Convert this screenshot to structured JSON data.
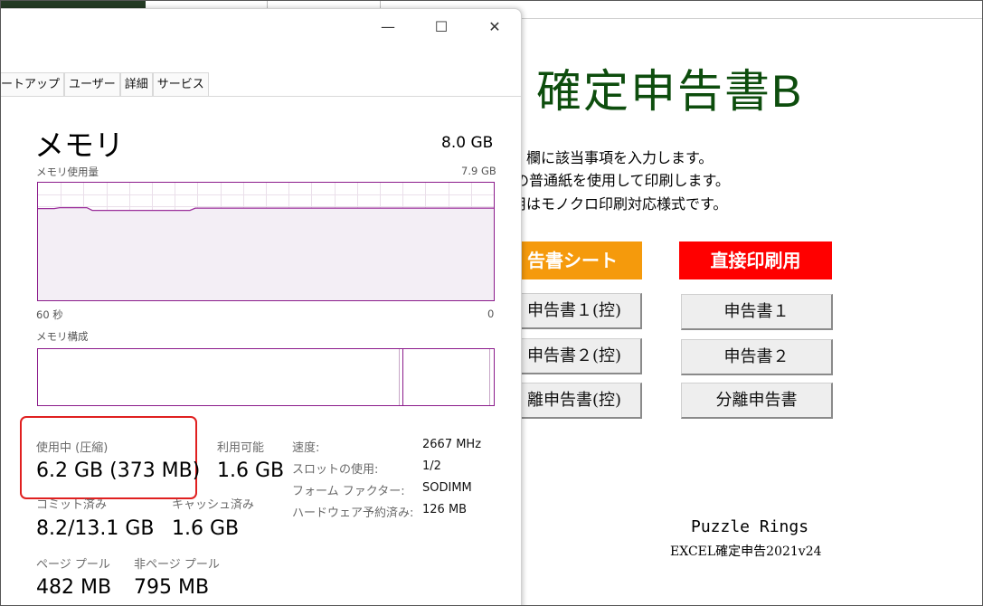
{
  "excel": {
    "title": "確定申告書B",
    "instructions": [
      "欄に該当事項を入力します。",
      "の普通紙を使用して印刷します。",
      "用はモノクロ印刷対応様式です。"
    ],
    "sections": {
      "sheet_header": "告書シート",
      "print_header": "直接印刷用"
    },
    "left_buttons": [
      "申告書１(控)",
      "申告書２(控)",
      "離申告書(控)"
    ],
    "right_buttons": [
      "申告書１",
      "申告書２",
      "分離申告書"
    ],
    "footer": {
      "brand": "Puzzle Rings",
      "version": "EXCEL確定申告2021v24"
    },
    "colors": {
      "title": "#0d4d0d",
      "sheet_header_bg": "#f59a0c",
      "print_header_bg": "#ff0000"
    }
  },
  "task_manager": {
    "window_controls": {
      "minimize": "—",
      "maximize": "☐",
      "close": "✕"
    },
    "tabs": [
      "ートアップ",
      "ユーザー",
      "詳細",
      "サービス"
    ],
    "memory": {
      "title": "メモリ",
      "total": "8.0 GB",
      "usage_label": "メモリ使用量",
      "usage_max": "7.9 GB",
      "time_start": "60 秒",
      "time_end": "0",
      "composition_label": "メモリ構成"
    },
    "stats": {
      "in_use_label": "使用中 (圧縮)",
      "in_use_value": "6.2 GB (373 MB)",
      "available_label": "利用可能",
      "available_value": "1.6 GB",
      "committed_label": "コミット済み",
      "committed_value": "8.2/13.1 GB",
      "cached_label": "キャッシュ済み",
      "cached_value": "1.6 GB",
      "paged_label": "ページ プール",
      "paged_value": "482 MB",
      "nonpaged_label": "非ページ プール",
      "nonpaged_value": "795 MB"
    },
    "specs": [
      {
        "label": "速度:",
        "value": "2667 MHz"
      },
      {
        "label": "スロットの使用:",
        "value": "1/2"
      },
      {
        "label": "フォーム ファクター:",
        "value": "SODIMM"
      },
      {
        "label": "ハードウェア予約済み:",
        "value": "126 MB"
      }
    ],
    "graph_usage_fraction": 0.78,
    "colors": {
      "graph_border": "#8b1b8b",
      "highlight": "#e02020"
    }
  }
}
